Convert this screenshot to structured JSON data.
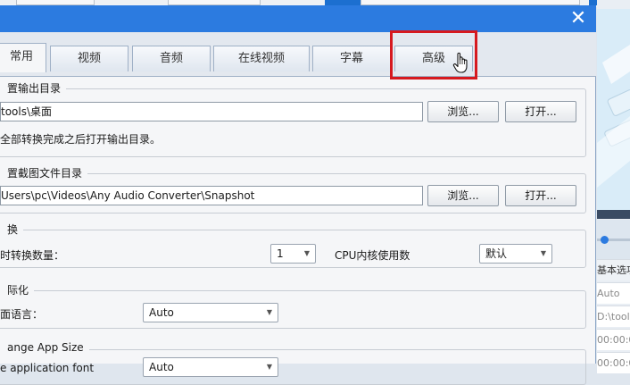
{
  "window": {
    "close_glyph": "✕"
  },
  "tabs": [
    {
      "label": "常用",
      "active": true
    },
    {
      "label": "视频",
      "active": false
    },
    {
      "label": "音频",
      "active": false
    },
    {
      "label": "在线视频",
      "active": false
    },
    {
      "label": "字幕",
      "active": false
    },
    {
      "label": "高级",
      "active": false,
      "highlighted": true
    }
  ],
  "output_dir": {
    "legend": "置输出目录",
    "path": "tools\\桌面",
    "browse": "浏览...",
    "open": "打开...",
    "checkbox_label": "全部转换完成之后打开输出目录。"
  },
  "snapshot_dir": {
    "legend": "置截图文件目录",
    "path": "Users\\pc\\Videos\\Any Audio Converter\\Snapshot",
    "browse": "浏览...",
    "open": "打开..."
  },
  "convert": {
    "legend": "换",
    "count_label": "时转换数量：",
    "count_value": "1",
    "cpu_label": "CPU内核使用数",
    "cpu_value": "默认"
  },
  "localization": {
    "legend": "际化",
    "lang_label": "面语言：",
    "lang_value": "Auto"
  },
  "app_size": {
    "legend": "ange App Size",
    "label": "e application font",
    "value": "Auto"
  },
  "right_panel": {
    "tab_label": "基本选项",
    "values": [
      "Auto",
      "D:\\tool",
      "00:00:0",
      "00:00:0"
    ]
  },
  "colors": {
    "titlebar": "#2c7be0",
    "highlight": "#d6191f"
  }
}
